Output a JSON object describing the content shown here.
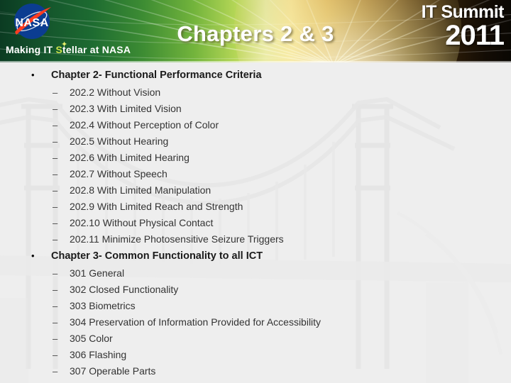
{
  "header": {
    "title": "Chapters 2 & 3",
    "nasa_logo_alt": "NASA",
    "tagline_prefix": "Making IT ",
    "tagline_s": "S",
    "tagline_suffix": "tellar at NASA",
    "summit_line1": "IT Summit",
    "summit_line2": "2011",
    "gradient_left": "#0b3b22",
    "gradient_mid": "#e4e9a6",
    "gradient_right": "#0a0703",
    "title_color": "#ffffff",
    "nasa_blue": "#0b3d91",
    "nasa_red": "#fc3d21",
    "stellar_accent": "#c9e24a"
  },
  "body": {
    "sections": [
      {
        "heading": "Chapter 2- Functional Performance Criteria",
        "bullet": "•",
        "sub_marker": "–",
        "items": [
          "202.2 Without Vision",
          "202.3 With Limited Vision",
          "202.4 Without Perception of Color",
          "202.5 Without Hearing",
          "202.6 With Limited Hearing",
          "202.7 Without Speech",
          "202.8 With Limited Manipulation",
          "202.9 With Limited Reach and Strength",
          "202.10 Without Physical Contact",
          "202.11 Minimize Photosensitive Seizure Triggers"
        ]
      },
      {
        "heading": "Chapter 3- Common Functionality to all ICT",
        "bullet": "•",
        "sub_marker": "–",
        "items": [
          "301 General",
          "302 Closed Functionality",
          "303 Biometrics",
          "304 Preservation of Information Provided for Accessibility",
          "305 Color",
          "306 Flashing",
          "307 Operable Parts"
        ]
      }
    ],
    "background_color": "#eeeeee",
    "watermark_subject": "suspension-bridge"
  }
}
